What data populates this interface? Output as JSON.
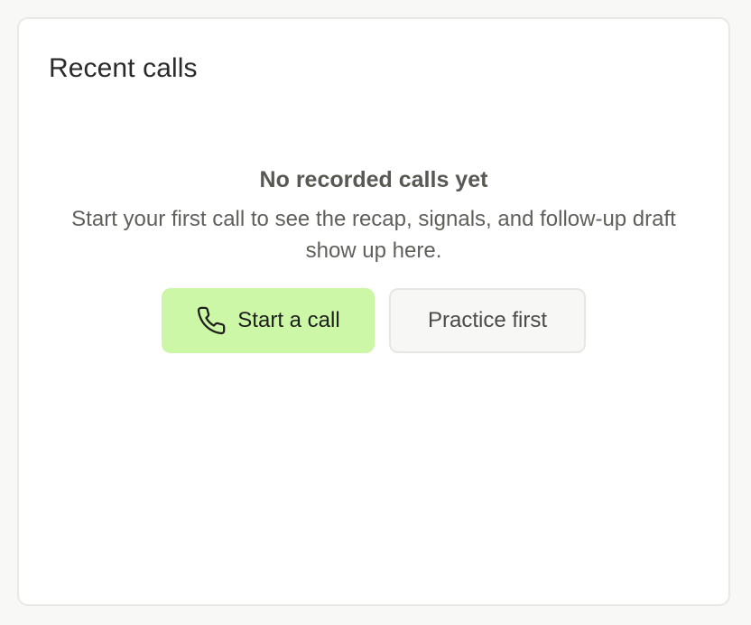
{
  "card": {
    "title": "Recent calls"
  },
  "empty_state": {
    "title": "No recorded calls yet",
    "description": "Start your first call to see the recap, signals, and follow-up draft show up here."
  },
  "actions": {
    "primary": {
      "label": "Start a call",
      "icon": "phone-icon"
    },
    "secondary": {
      "label": "Practice first"
    }
  },
  "colors": {
    "primary_button_bg": "#cbf7a6",
    "secondary_button_bg": "#f7f7f5",
    "card_bg": "#ffffff",
    "page_bg": "#f8f8f6"
  }
}
